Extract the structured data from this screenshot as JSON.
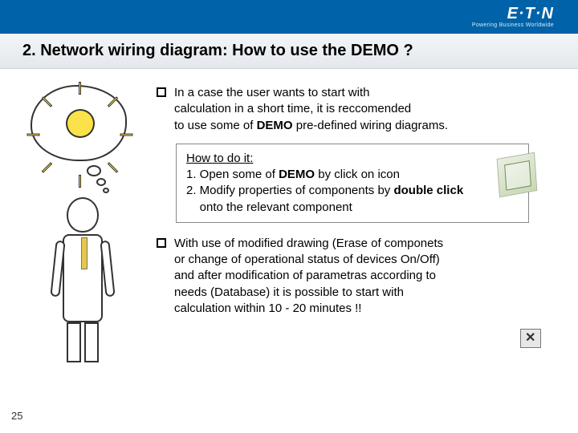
{
  "brand": {
    "logo": "E·T·N",
    "tagline": "Powering Business Worldwide"
  },
  "title": "2. Network wiring diagram: How to use the DEMO ?",
  "bullet1": {
    "line1": "In a case the user wants to start with",
    "line2": "calculation in a short time, it is reccomended",
    "line3_pre": "to use some of ",
    "line3_bold": "DEMO",
    "line3_post": " pre-defined wiring diagrams."
  },
  "howto": {
    "title": "How to do it:",
    "step1_pre": "1. Open some of ",
    "step1_bold": "DEMO",
    "step1_post": " by click on icon",
    "step2_pre": "2. Modify properties of components by ",
    "step2_bold": "double click",
    "step2_line2": "onto the relevant component"
  },
  "bullet2": {
    "line1": "With use of modified drawing (Erase of componets",
    "line2": "or change of operational status of devices On/Off)",
    "line3": "and after modification of parametras according to",
    "line4": "needs (Database) it is possible to start with",
    "line5": "calculation within 10 - 20 minutes !!"
  },
  "page_number": "25"
}
